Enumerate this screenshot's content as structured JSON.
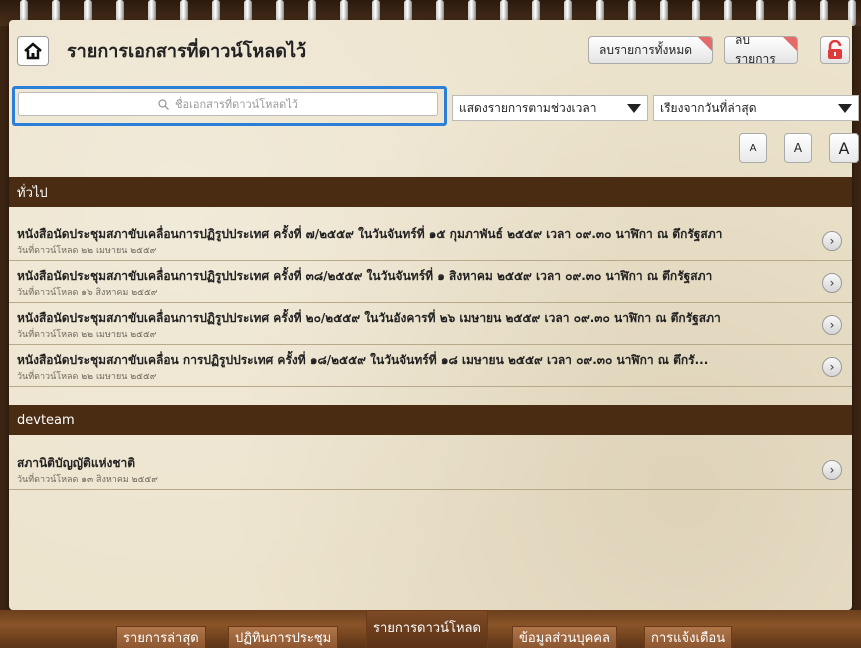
{
  "header": {
    "title": "รายการเอกสารที่ดาวน์โหลดไว้",
    "delete_all_label": "ลบรายการทั้งหมด",
    "delete_label": "ลบรายการ"
  },
  "search": {
    "placeholder": "ชื่อเอกสารที่ดาวน์โหลดไว้"
  },
  "filters": {
    "time_range": "แสดงรายการตามช่วงเวลา",
    "sort": "เรียงจากวันที่ล่าสุด"
  },
  "font_sizes": [
    "A",
    "A",
    "A"
  ],
  "sections": [
    {
      "name": "ทั่วไป",
      "items": [
        {
          "title": "หนังสือนัดประชุมสภาขับเคลื่อนการปฏิรูปประเทศ ครั้งที่ ๗/๒๕๕๙ ในวันจันทร์ที่ ๑๕ กุมภาพันธ์ ๒๕๕๙ เวลา ๐๙.๓๐ นาฬิกา ณ ตึกรัฐสภา",
          "date": "วันที่ดาวน์โหลด ๒๒ เมษายน ๒๕๕๙"
        },
        {
          "title": "หนังสือนัดประชุมสภาขับเคลื่อนการปฏิรูปประเทศ ครั้งที่ ๓๘/๒๕๕๙ ในวันจันทร์ที่ ๑ สิงหาคม ๒๕๕๙ เวลา ๐๙.๓๐ นาฬิกา ณ ตึกรัฐสภา",
          "date": "วันที่ดาวน์โหลด ๑๖ สิงหาคม ๒๕๕๙"
        },
        {
          "title": "หนังสือนัดประชุมสภาขับเคลื่อนการปฏิรูปประเทศ ครั้งที่ ๒๐/๒๕๕๙ ในวันอังคารที่ ๒๖ เมษายน ๒๕๕๙ เวลา ๐๙.๓๐ นาฬิกา  ณ ตึกรัฐสภา",
          "date": "วันที่ดาวน์โหลด ๒๒ เมษายน ๒๕๕๙"
        },
        {
          "title": "หนังสือนัดประชุมสภาขับเคลื่อน    การปฏิรูปประเทศ ครั้งที่ ๑๘/๒๕๕๙ ในวันจันทร์ที่ ๑๘ เมษายน ๒๕๕๙ เวลา ๐๙.๓๐ นาฬิกา        ณ ตึกรั...",
          "date": "วันที่ดาวน์โหลด ๒๒ เมษายน ๒๕๕๙"
        }
      ]
    },
    {
      "name": "devteam",
      "items": [
        {
          "title": "สภานิติบัญญัติแห่งชาติ",
          "date": "วันที่ดาวน์โหลด ๑๓ สิงหาคม ๒๕๕๙"
        }
      ]
    }
  ],
  "bottom_nav": [
    {
      "label": "รายการล่าสุด"
    },
    {
      "label": "ปฏิทินการประชุม"
    },
    {
      "label": "รายการดาวน์โหลด"
    },
    {
      "label": "ข้อมูลส่วนบุคคล"
    },
    {
      "label": "การแจ้งเตือน"
    }
  ],
  "colors": {
    "section_header": "#4a2c12",
    "search_highlight": "#2b7fd6",
    "delete_corner": "#e56a6a",
    "lock": "#e03a3a"
  }
}
